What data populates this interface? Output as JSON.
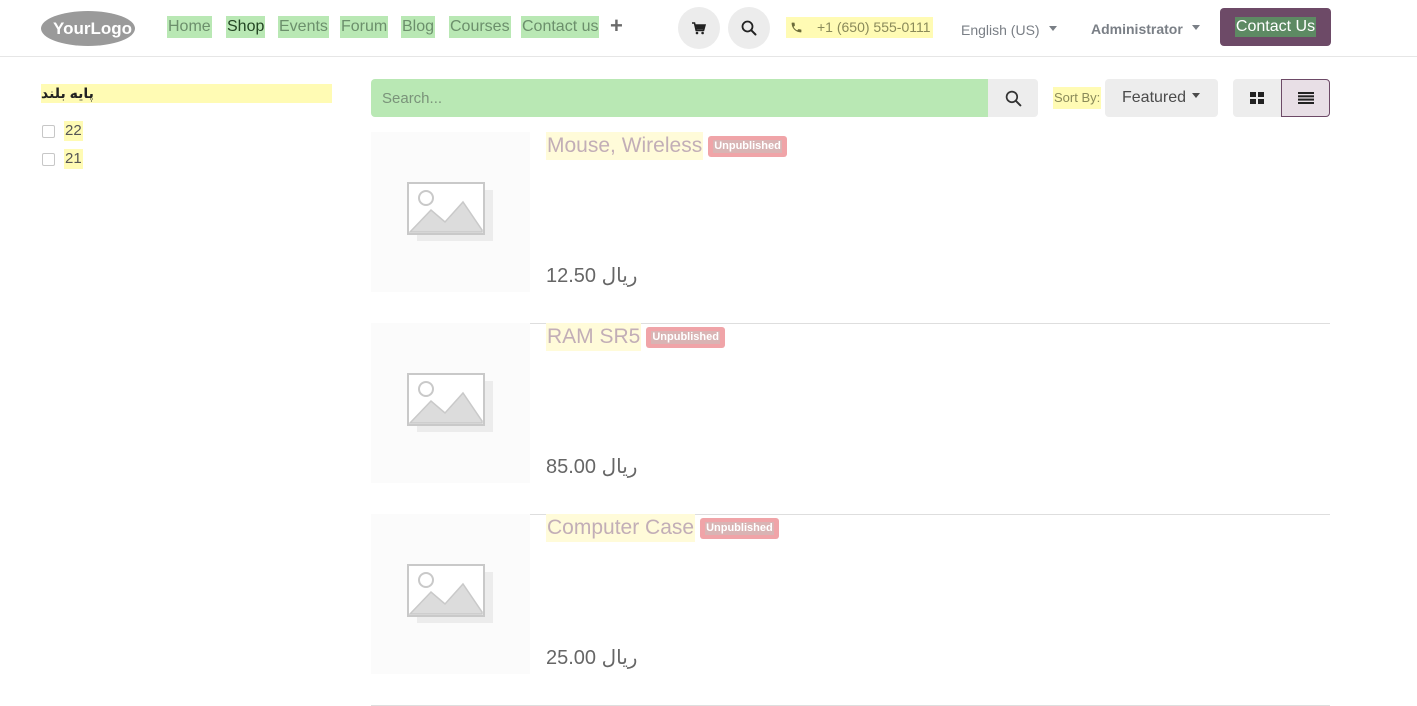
{
  "header": {
    "logo_text": "YourLogo",
    "nav": [
      "Home",
      "Shop",
      "Events",
      "Forum",
      "Blog",
      "Courses",
      "Contact us"
    ],
    "active_nav": "Shop",
    "phone": "+1 (650) 555-0111",
    "language": "English (US)",
    "user": "Administrator",
    "contact_button": "Contact Us"
  },
  "sidebar": {
    "filter_title": "پایه بلند",
    "options": [
      "22",
      "21"
    ]
  },
  "toolbar": {
    "search_placeholder": "Search...",
    "sort_label": "Sort By:",
    "sort_value": "Featured"
  },
  "products": [
    {
      "name": "Mouse, Wireless",
      "badge": "Unpublished",
      "price": "ریال 12.50"
    },
    {
      "name": "RAM SR5",
      "badge": "Unpublished",
      "price": "ریال 85.00"
    },
    {
      "name": "Computer Case",
      "badge": "Unpublished",
      "price": "ریال 25.00"
    }
  ],
  "colors": {
    "brand": "#6d4a67",
    "highlight_green": "#b9e8b4",
    "highlight_yellow": "#fffbb4",
    "badge": "#f0a4a8"
  }
}
